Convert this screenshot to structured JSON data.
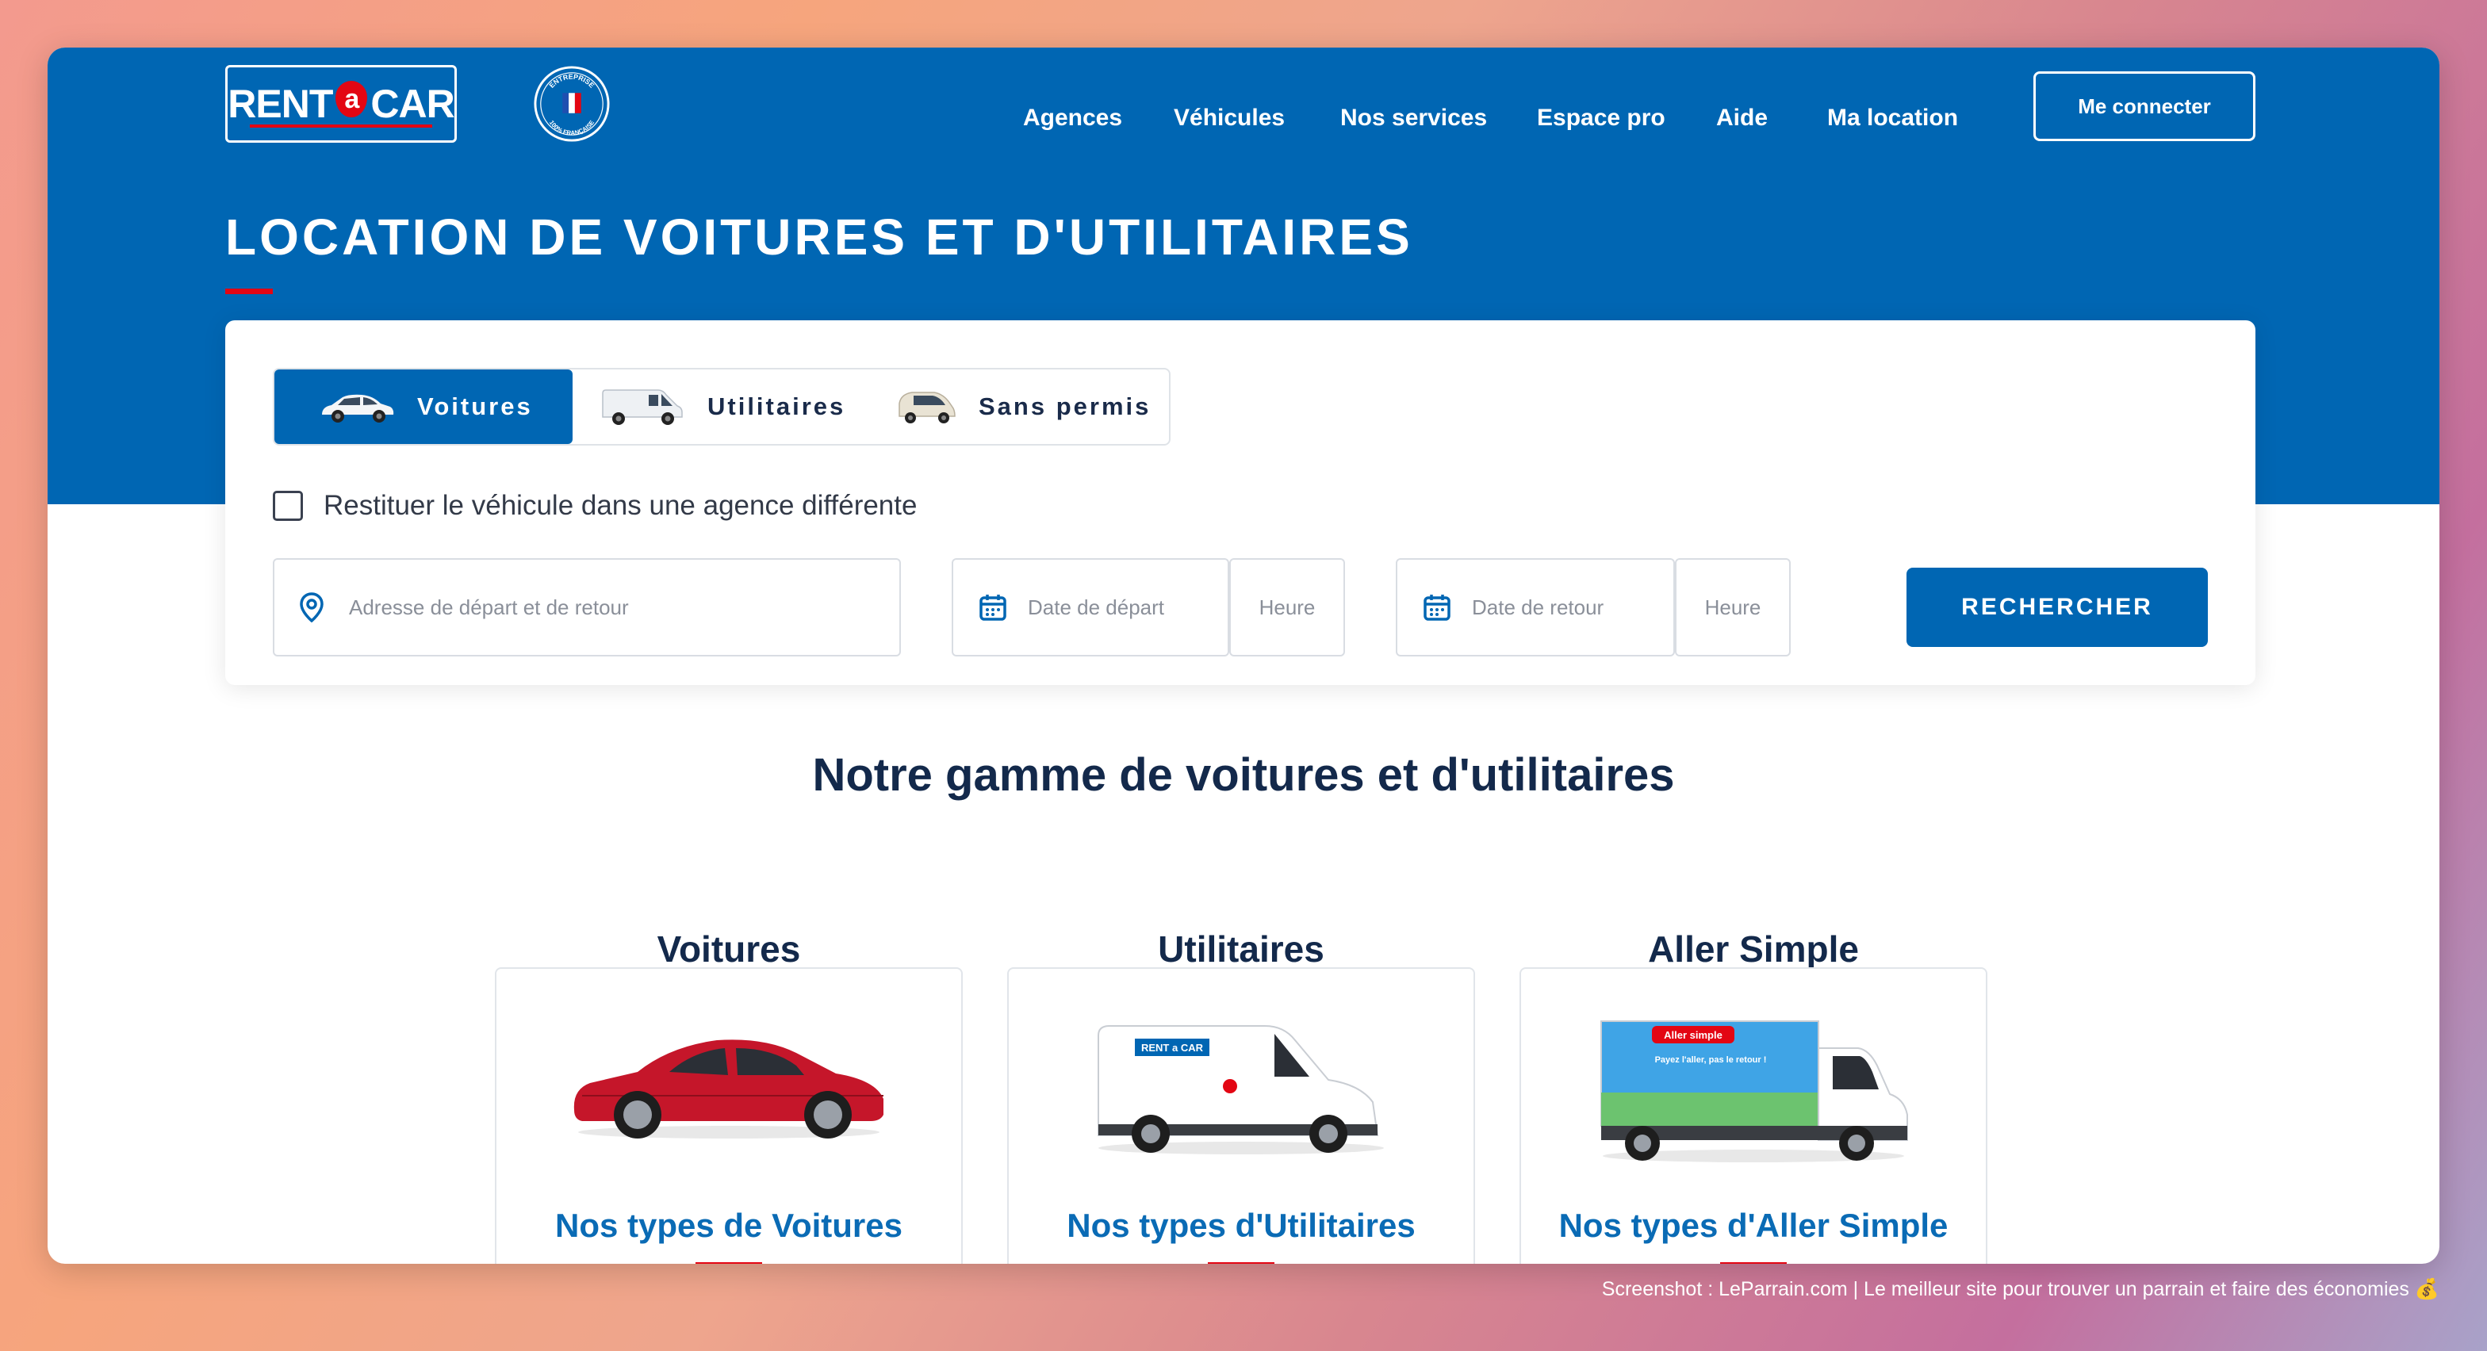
{
  "header": {
    "logo_left": "RENT",
    "logo_a": "a",
    "logo_right": "CAR",
    "seal_text": "ENTREPRISE 100% FRANÇAISE",
    "nav": [
      "Agences",
      "Véhicules",
      "Nos services",
      "Espace pro",
      "Aide",
      "Ma location"
    ],
    "login_label": "Me connecter"
  },
  "hero": {
    "title": "LOCATION DE VOITURES ET D'UTILITAIRES"
  },
  "search": {
    "tabs": [
      {
        "label": "Voitures",
        "active": true,
        "icon": "car-icon"
      },
      {
        "label": "Utilitaires",
        "active": false,
        "icon": "van-icon"
      },
      {
        "label": "Sans permis",
        "active": false,
        "icon": "microcar-icon"
      }
    ],
    "checkbox_label": "Restituer le véhicule dans une agence différente",
    "checkbox_checked": false,
    "address_placeholder": "Adresse de départ et de retour",
    "departure_date_placeholder": "Date de départ",
    "departure_time_placeholder": "Heure",
    "return_date_placeholder": "Date de retour",
    "return_time_placeholder": "Heure",
    "search_label": "RECHERCHER"
  },
  "range": {
    "title": "Notre gamme de voitures et d'utilitaires",
    "cards": [
      {
        "title": "Voitures",
        "link": "Nos types de Voitures"
      },
      {
        "title": "Utilitaires",
        "link": "Nos types d'Utilitaires"
      },
      {
        "title": "Aller Simple",
        "link": "Nos types d'Aller Simple"
      }
    ],
    "van_logo": "RENT a CAR",
    "truck_banner": "Aller simple",
    "truck_slogan": "Payez l'aller, pas le retour !"
  },
  "caption": "Screenshot : LeParrain.com | Le meilleur site pour trouver un parrain et faire des économies 💰",
  "colors": {
    "brand_blue": "#0066b3",
    "brand_red": "#e30613",
    "heading_navy": "#13294b"
  }
}
